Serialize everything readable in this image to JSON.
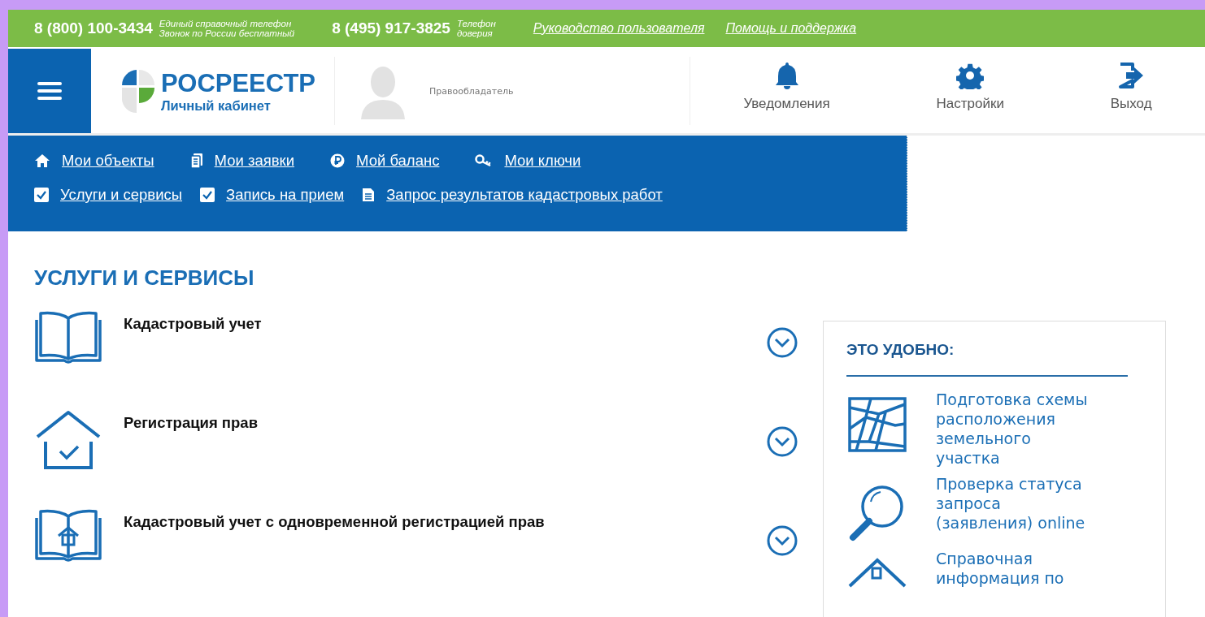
{
  "top_bar": {
    "phones": [
      {
        "number": "8 (800) 100-3434",
        "note_lines": [
          "Единый справочный телефон",
          "Звонок по России бесплатный"
        ]
      },
      {
        "number": "8 (495) 917-3825",
        "note_lines": [
          "Телефон",
          "доверия"
        ]
      }
    ],
    "links": [
      "Руководство пользователя",
      "Помощь и поддержка"
    ]
  },
  "header": {
    "logo_title": "РОСРЕЕСТР",
    "logo_subtitle": "Личный кабинет",
    "user_role": "Правообладатель",
    "actions": [
      {
        "kind": "bell",
        "label": "Уведомления"
      },
      {
        "kind": "gear",
        "label": "Настройки"
      },
      {
        "kind": "exit",
        "label": "Выход"
      }
    ]
  },
  "nav": {
    "rows": [
      [
        {
          "kind": "home",
          "label": "Мои объекты"
        },
        {
          "kind": "docs",
          "label": "Мои заявки"
        },
        {
          "kind": "ruble",
          "label": "Мой баланс"
        },
        {
          "kind": "key",
          "label": "Мои ключи"
        }
      ],
      [
        {
          "kind": "check",
          "label": "Услуги и сервисы"
        },
        {
          "kind": "check",
          "label": "Запись на прием"
        },
        {
          "kind": "doc",
          "label": "Запрос результатов кадастровых работ"
        }
      ]
    ]
  },
  "page_title": "УСЛУГИ И СЕРВИСЫ",
  "services": [
    {
      "kind": "book",
      "title": "Кадастровый учет",
      "expanded": false
    },
    {
      "kind": "house",
      "title": "Регистрация прав",
      "expanded": false
    },
    {
      "kind": "bookhouse",
      "title": "Кадастровый учет с одновременной регистрацией прав",
      "expanded": false
    }
  ],
  "sidebar": {
    "title": "ЭТО УДОБНО:",
    "items": [
      {
        "kind": "map",
        "label": "Подготовка схемы расположения земельного участка"
      },
      {
        "kind": "search",
        "label": "Проверка статуса запроса (заявления) online"
      },
      {
        "kind": "house",
        "label": "Справочная информация по"
      }
    ]
  }
}
